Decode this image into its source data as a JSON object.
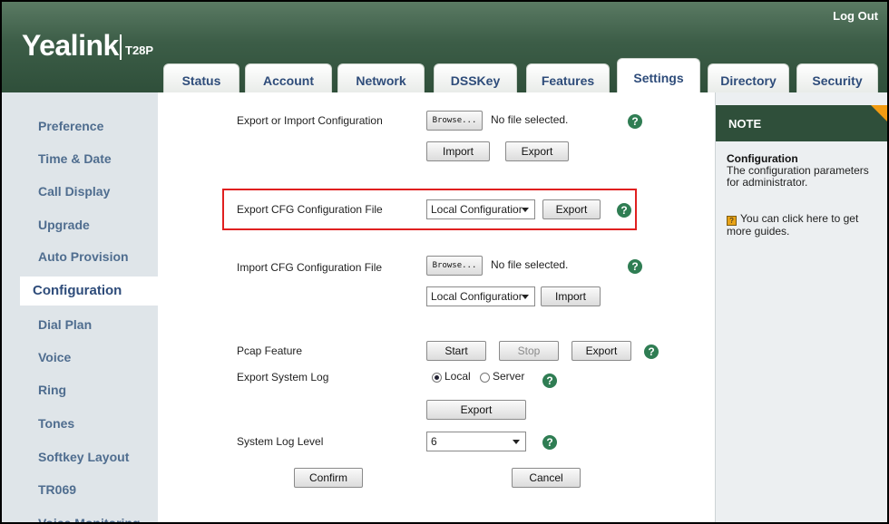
{
  "header": {
    "logo": "Yealink",
    "model": "T28P",
    "logout": "Log Out"
  },
  "tabs": [
    "Status",
    "Account",
    "Network",
    "DSSKey",
    "Features",
    "Settings",
    "Directory",
    "Security"
  ],
  "active_tab": "Settings",
  "nav": {
    "items": [
      "Preference",
      "Time & Date",
      "Call Display",
      "Upgrade",
      "Auto Provision",
      "Configuration",
      "Dial Plan",
      "Voice",
      "Ring",
      "Tones",
      "Softkey Layout",
      "TR069",
      "Voice Monitoring"
    ],
    "active": "Configuration"
  },
  "main": {
    "export_import_label": "Export or Import Configuration",
    "browse": "Browse...",
    "no_file": "No file selected.",
    "import": "Import",
    "export": "Export",
    "export_cfg_label": "Export CFG Configuration File",
    "local_config": "Local Configuratior",
    "import_cfg_label": "Import CFG Configuration File",
    "pcap_label": "Pcap Feature",
    "start": "Start",
    "stop": "Stop",
    "export_log_label": "Export System Log",
    "radio_local": "Local",
    "radio_server": "Server",
    "log_level_label": "System Log Level",
    "log_level_value": "6",
    "confirm": "Confirm",
    "cancel": "Cancel",
    "help": "?"
  },
  "note": {
    "header": "NOTE",
    "title": "Configuration",
    "text": "The configuration parameters for administrator.",
    "guide": "You can click here to get more guides.",
    "guide_icon": "?"
  },
  "colors": {
    "header_green": "#2f4f3a",
    "nav_text": "#4f6d8f",
    "highlight": "#e02020",
    "help_icon": "#2f7d53",
    "note_corner": "#f39c12"
  }
}
